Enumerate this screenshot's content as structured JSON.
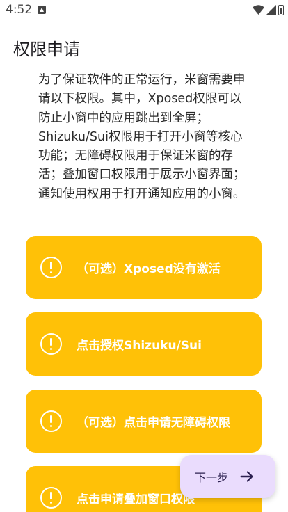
{
  "status_bar": {
    "time": "4:52",
    "icons": [
      "notification-app-icon",
      "wifi-icon",
      "signal-icon",
      "battery-icon"
    ]
  },
  "page": {
    "title": "权限申请",
    "description": "为了保证软件的正常运行，米窗需要申请以下权限。其中，Xposed权限可以防止小窗中的应用跳出到全屏；Shizuku/Sui权限用于打开小窗等核心功能；无障碍权限用于保证米窗的存活；叠加窗口权限用于展示小窗界面；通知使用权用于打开通知应用的小窗。"
  },
  "permissions": [
    {
      "label": "（可选）Xposed没有激活",
      "icon": "warning-icon"
    },
    {
      "label": "点击授权Shizuku/Sui",
      "icon": "warning-icon"
    },
    {
      "label": "（可选）点击申请无障碍权限",
      "icon": "warning-icon"
    },
    {
      "label": "点击申请叠加窗口权限",
      "icon": "warning-icon"
    }
  ],
  "next_button": {
    "label": "下一步",
    "icon": "arrow-right-icon"
  },
  "colors": {
    "card": "#ffc107",
    "card_text": "#ffffff",
    "fab_background": "#eadcfd",
    "fab_text": "#2b1f4f"
  }
}
